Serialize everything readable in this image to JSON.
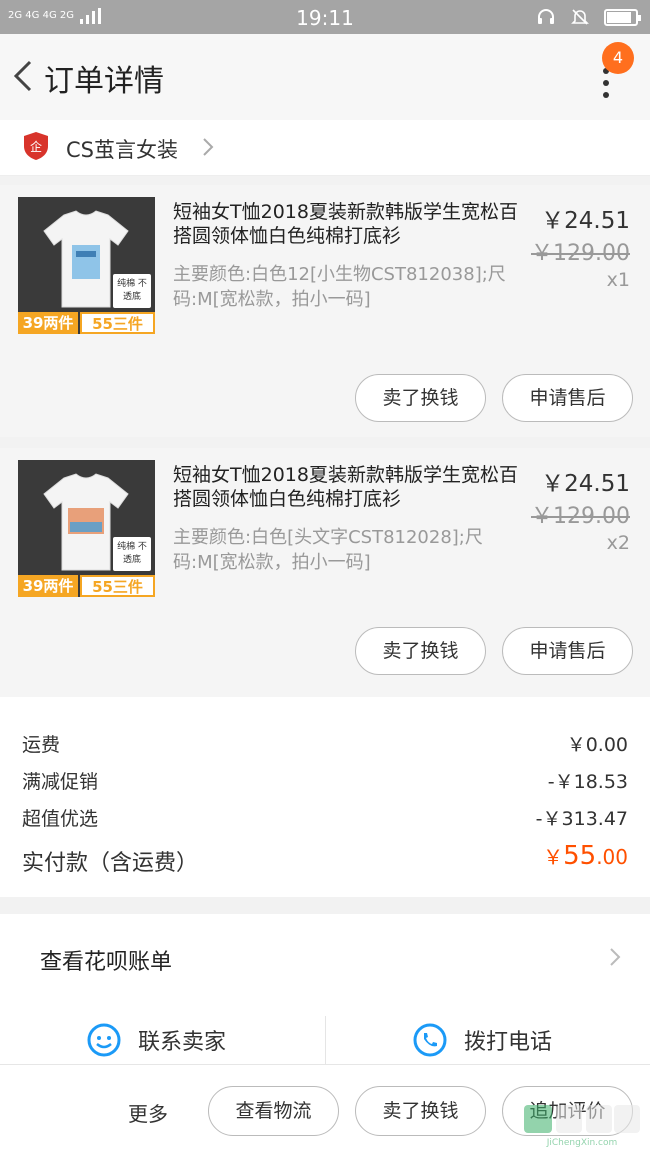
{
  "status_bar": {
    "network": "2G 4G 4G 2G",
    "time": "19:11"
  },
  "header": {
    "title": "订单详情",
    "badge_count": "4"
  },
  "shop": {
    "name": "CS茧言女装",
    "logo_glyph": "企"
  },
  "items": [
    {
      "name": "短袖女T恤2018夏装新款韩版学生宽松百搭圆领体恤白色纯棉打底衫",
      "spec": "主要颜色:白色12[小生物CST812038];尺码:M[宽松款，拍小一码]",
      "price": "￥24.51",
      "original_price": "￥129.00",
      "quantity": "x1",
      "promo_tag1": "39两件",
      "promo_tag2": "55三件",
      "thumb_note": "纯棉 不透底",
      "btn_sell": "卖了换钱",
      "btn_aftersale": "申请售后"
    },
    {
      "name": "短袖女T恤2018夏装新款韩版学生宽松百搭圆领体恤白色纯棉打底衫",
      "spec": "主要颜色:白色[头文字CST812028];尺码:M[宽松款，拍小一码]",
      "price": "￥24.51",
      "original_price": "￥129.00",
      "quantity": "x2",
      "promo_tag1": "39两件",
      "promo_tag2": "55三件",
      "thumb_note": "纯棉 不透底",
      "btn_sell": "卖了换钱",
      "btn_aftersale": "申请售后"
    }
  ],
  "summary": {
    "shipping_label": "运费",
    "shipping_value": "￥0.00",
    "discount_label": "满减促销",
    "discount_value": "-￥18.53",
    "preferred_label": "超值优选",
    "preferred_value": "-￥313.47",
    "total_label": "实付款（含运费）",
    "total_symbol": "￥",
    "total_integer": "55",
    "total_decimal": ".00"
  },
  "huabei": {
    "label": "查看花呗账单"
  },
  "contact": {
    "seller_label": "联系卖家",
    "phone_label": "拨打电话"
  },
  "bottom_bar": {
    "more_label": "更多",
    "logistics_label": "查看物流",
    "sell_label": "卖了换钱",
    "review_label": "追加评价"
  },
  "watermark": {
    "text": "JiChengXin.com"
  },
  "colors": {
    "accent": "#ff5000",
    "badge": "#ff6f1e",
    "link_blue": "#1b9af7"
  }
}
